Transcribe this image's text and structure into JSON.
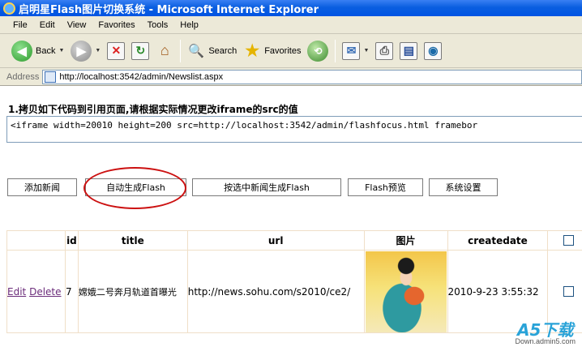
{
  "window": {
    "title": "启明星Flash图片切换系统 - Microsoft Internet Explorer"
  },
  "menubar": {
    "items": [
      "File",
      "Edit",
      "View",
      "Favorites",
      "Tools",
      "Help"
    ]
  },
  "toolbar": {
    "back_label": "Back",
    "search_label": "Search",
    "favorites_label": "Favorites"
  },
  "address": {
    "label": "Address",
    "url": "http://localhost:3542/admin/Newslist.aspx"
  },
  "page": {
    "instruction": "1.拷贝如下代码到引用页面,请根据实际情况更改iframe的src的值",
    "code": "<iframe width=20010 height=200 src=http://localhost:3542/admin/flashfocus.html   framebor",
    "buttons": {
      "add_news": "添加新闻",
      "auto_generate": "自动生成Flash",
      "generate_selected": "按选中新闻生成Flash",
      "preview": "Flash预览",
      "settings": "系统设置"
    },
    "table": {
      "headers": [
        "",
        "id",
        "title",
        "url",
        "图片",
        "createdate",
        ""
      ],
      "row": {
        "edit": "Edit",
        "delete": "Delete",
        "id": "7",
        "title": "嫦娥二号奔月轨道首曝光",
        "url": "http://news.sohu.com/s2010/ce2/",
        "createdate": "2010-9-23 3:55:32"
      }
    }
  },
  "watermark": {
    "brand": "A5下载",
    "site": "Down.admin5.com"
  },
  "colors": {
    "titlebar": "#0054e3",
    "chrome": "#ece9d8",
    "highlight_ring": "#cc1111",
    "link_visited": "#6b2c7a",
    "table_border": "#f0dfc8"
  }
}
